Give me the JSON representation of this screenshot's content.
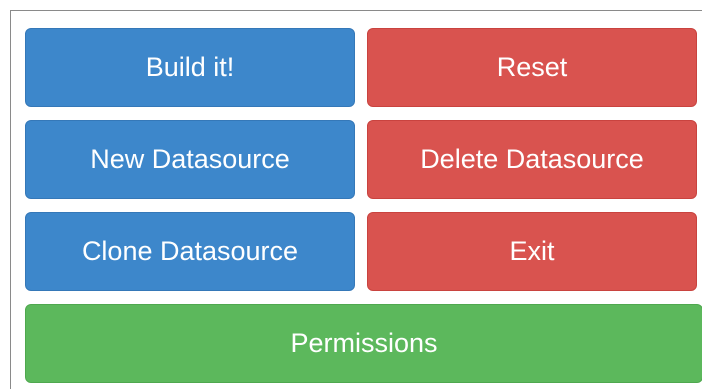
{
  "buttons": {
    "build": "Build it!",
    "reset": "Reset",
    "new_datasource": "New Datasource",
    "delete_datasource": "Delete Datasource",
    "clone_datasource": "Clone Datasource",
    "exit": "Exit",
    "permissions": "Permissions"
  },
  "colors": {
    "primary_blue": "#3d87cb",
    "danger_red": "#d9534f",
    "success_green": "#5cb85c"
  }
}
